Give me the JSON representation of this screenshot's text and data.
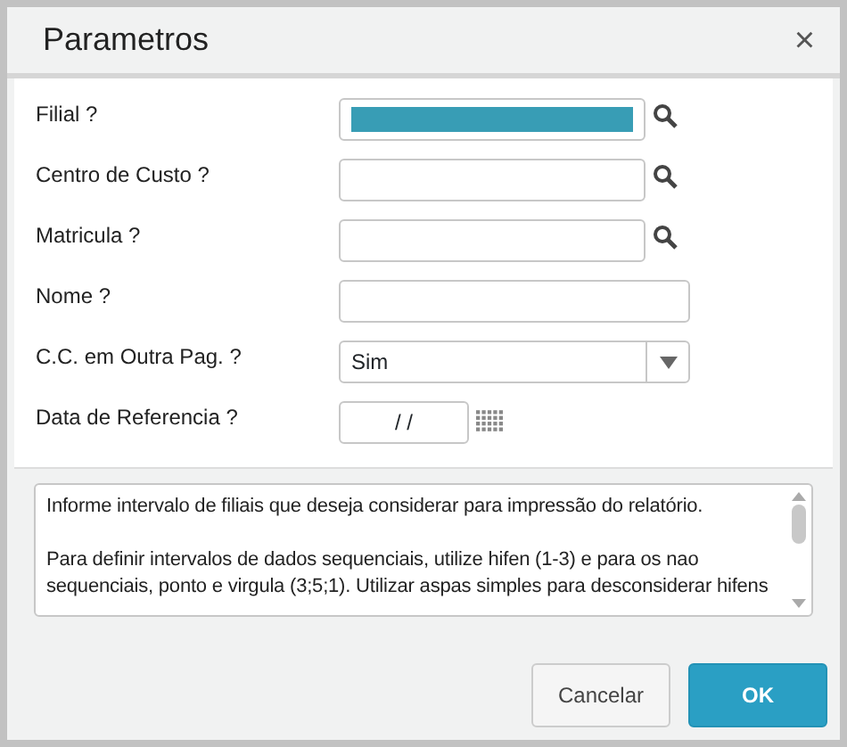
{
  "dialog": {
    "title": "Parametros",
    "close": "×"
  },
  "fields": [
    {
      "label": "Filial ?",
      "kind": "lookup",
      "highlighted": true
    },
    {
      "label": "Centro de Custo ?",
      "kind": "lookup",
      "highlighted": false
    },
    {
      "label": "Matricula ?",
      "kind": "lookup",
      "highlighted": false
    },
    {
      "label": "Nome ?",
      "kind": "text",
      "highlighted": false
    },
    {
      "label": "C.C. em Outra Pag. ?",
      "kind": "select",
      "value": "Sim",
      "highlighted": false
    },
    {
      "label": "Data de Referencia ?",
      "kind": "date",
      "value": "/ /",
      "highlighted": false
    }
  ],
  "help": {
    "paragraphs": [
      "Informe intervalo de filiais que deseja considerar para impressão do relatório.",
      "Para definir intervalos de dados sequenciais, utilize hifen (1-3) e para os nao sequenciais, ponto e virgula (3;5;1). Utilizar aspas simples para desconsiderar hifens"
    ]
  },
  "buttons": [
    {
      "label": "Cancelar",
      "kind": "secondary"
    },
    {
      "label": "OK",
      "kind": "primary"
    }
  ]
}
